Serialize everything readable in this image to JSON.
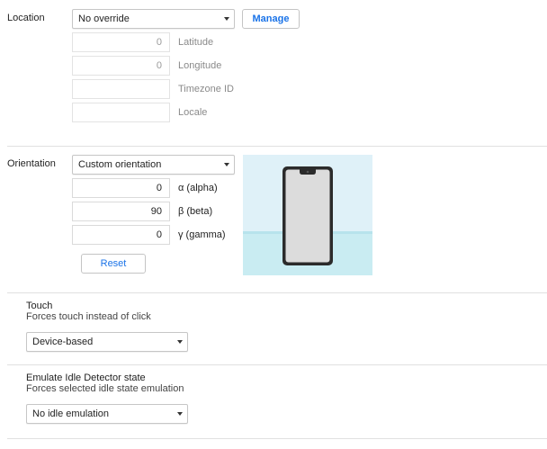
{
  "location": {
    "label": "Location",
    "select_value": "No override",
    "manage_label": "Manage",
    "latitude": {
      "value": "0",
      "label": "Latitude"
    },
    "longitude": {
      "value": "0",
      "label": "Longitude"
    },
    "timezone": {
      "value": "",
      "label": "Timezone ID"
    },
    "locale": {
      "value": "",
      "label": "Locale"
    }
  },
  "orientation": {
    "label": "Orientation",
    "select_value": "Custom orientation",
    "alpha": {
      "value": "0",
      "label": "α (alpha)"
    },
    "beta": {
      "value": "90",
      "label": "β (beta)"
    },
    "gamma": {
      "value": "0",
      "label": "γ (gamma)"
    },
    "reset_label": "Reset",
    "preview_colors": {
      "sky": "#dff1f8",
      "ground": "#c9ecf2",
      "phone_body": "#2b2b2b",
      "phone_screen": "#dcdcdc"
    }
  },
  "touch": {
    "title": "Touch",
    "description": "Forces touch instead of click",
    "select_value": "Device-based"
  },
  "idle": {
    "title": "Emulate Idle Detector state",
    "description": "Forces selected idle state emulation",
    "select_value": "No idle emulation"
  }
}
